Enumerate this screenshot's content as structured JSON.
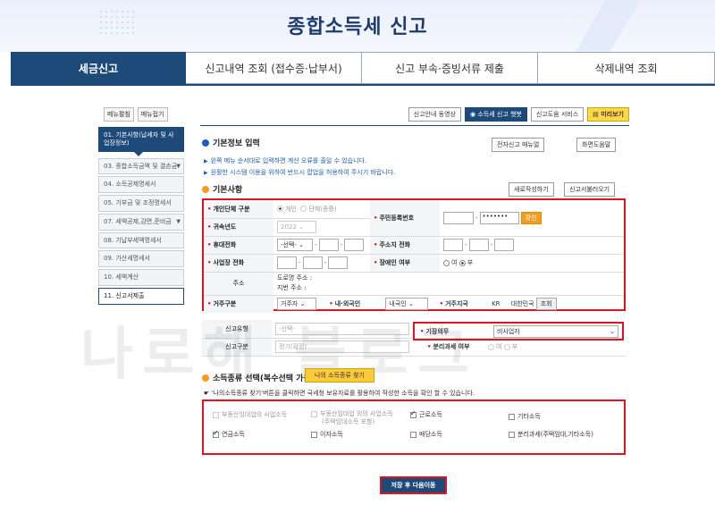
{
  "page_title": "종합소득세 신고",
  "tabs": [
    {
      "label": "세금신고",
      "active": true
    },
    {
      "label": "신고내역 조회 (접수증·납부서)"
    },
    {
      "label": "신고 부속·증빙서류 제출"
    },
    {
      "label": "삭제내역 조회"
    }
  ],
  "sidebar": {
    "expand": "메뉴펼침",
    "collapse": "메뉴접기",
    "items": [
      "01. 기본사항(납세자 및 사업장정보)",
      "03. 종합소득금액 및 결손금",
      "04. 소득공제명세서",
      "05. 기부금 및 조정명세서",
      "07. 세액공제,감면,준비금",
      "08. 기납부세액명세서",
      "09. 가산세명세서",
      "10. 세액계산",
      "11. 신고서제출"
    ]
  },
  "toolbar": {
    "guide_video": "신고안내 동영상",
    "chatbot": "소득세 신고 챗봇",
    "help_service": "신고도움 서비스",
    "preview": "미리보기",
    "manual": "전자신고 매뉴얼",
    "screen_help": "화면도움말",
    "new_write": "새로작성하기",
    "load": "신고서불러오기",
    "find_income": "나의 소득종류 찾기",
    "verify": "확인",
    "lookup": "조회",
    "save_next": "저장 후 다음이동"
  },
  "sections": {
    "basic_input": "기본정보 입력",
    "basic": "기본사항",
    "income_type": "소득종류 선택(복수선택 가능)"
  },
  "notes": [
    "왼쪽 메뉴 순서대로 입력하면 계산 오류를 줄일 수 있습니다.",
    "원활한 시스템 이용을 위하여 반드시 팝업을 허용하여 주시기 바랍니다."
  ],
  "income_note": "'나의소득종류 찾기'버튼을 클릭하면 국세청 보유자료를 활용하여 작성한 소득을 확인 할 수 있습니다.",
  "form": {
    "labels": {
      "person_type": "개인단체 구분",
      "rrn": "주민등록번호",
      "year": "귀속년도",
      "mobile": "휴대전화",
      "home_phone": "주소지 전화",
      "biz_phone": "사업장 전화",
      "disabled": "장애인 여부",
      "address": "주소",
      "residence": "거주구분",
      "nationality": "내·외국인",
      "country": "거주지국",
      "report_type": "신고유형",
      "bookkeeping": "기장의무",
      "report_kind": "신고구분",
      "separate_tax": "분리과세 여부"
    },
    "values": {
      "opt_individual": "개인",
      "opt_group": "단체(종중)",
      "rrn_masked": "•••••••",
      "year": "2022",
      "mobile_prefix": "-선택-",
      "yes": "여",
      "no": "부",
      "road_addr": "도로명 주소 :",
      "lot_addr": "지번 주소 :",
      "residence": "거주자",
      "nationality": "내국인",
      "country_code": "KR",
      "country_name": "대한민국",
      "report_type": "-선택-",
      "bookkeeping": "비사업자",
      "report_kind": "정기(확정)",
      "sep_yes": "여",
      "sep_no": "부"
    }
  },
  "income_types": [
    {
      "label": "부동산임대업의 사업소득",
      "checked": false,
      "disabled": true
    },
    {
      "label": "부동산임대업 외의 사업소득",
      "sub": "(주택임대소득 포함)",
      "checked": false,
      "disabled": true
    },
    {
      "label": "근로소득",
      "checked": true
    },
    {
      "label": "기타소득",
      "checked": false
    },
    {
      "label": "연금소득",
      "checked": true
    },
    {
      "label": "이자소득",
      "checked": false
    },
    {
      "label": "배당소득",
      "checked": false
    },
    {
      "label": "분리과세(주택임대,기타소득)",
      "checked": false
    }
  ],
  "watermark": "나로해 블로그",
  "colors": {
    "primary": "#1e4a7a",
    "highlight": "#e0141e",
    "accent": "#f39c1f"
  }
}
